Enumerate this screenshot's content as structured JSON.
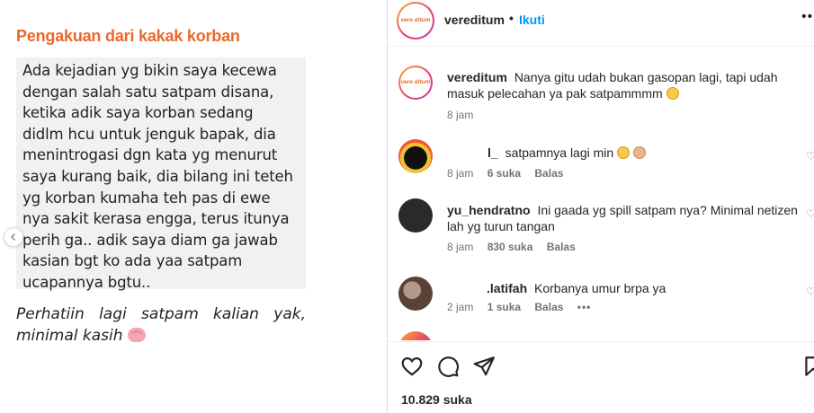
{
  "post": {
    "heading": "Pengakuan dari kakak korban",
    "quote": "Ada kejadian yg bikin saya kecewa\ndengan salah satu satpam disana,\nketika adik saya korban sedang\ndidlm hcu untuk jenguk bapak, dia\nmenintrogasi dgn kata yg menurut\nsaya kurang baik, dia bilang ini teteh\nyg korban kumaha teh pas di ewe\nnya sakit kerasa engga, terus itunya\nperih ga.. adik saya diam ga jawab\nkasian bgt ko ada yaa satpam\nucapannya bgtu..",
    "caption": "Perhatiin lagi satpam kalian yak, minimal kasih",
    "brain_emoji": "brain-emoji"
  },
  "header": {
    "avatar_text": "vere ditum",
    "username": "vereditum",
    "dot": "•",
    "follow_label": "Ikuti",
    "more_label": "••"
  },
  "caption_comment": {
    "username": "vereditum",
    "text": "Nanya gitu udah bukan gasopan lagi, tapi udah masuk pelecahan ya pak satpammmm",
    "time": "8 jam"
  },
  "comments": [
    {
      "username": "l_",
      "text": "satpamnya lagi min",
      "time": "8 jam",
      "likes": "6 suka",
      "reply": "Balas"
    },
    {
      "username": "yu_hendratno",
      "text": "Ini gaada yg spill satpam nya? Minimal netizen lah yg turun tangan",
      "time": "8 jam",
      "likes": "830 suka",
      "reply": "Balas"
    },
    {
      "username": ".latifah",
      "text": "Korbanya umur brpa ya",
      "time": "2 jam",
      "likes": "1 suka",
      "reply": "Balas",
      "more": "•••"
    }
  ],
  "actions": {
    "likes_count": "10.829 suka"
  },
  "colors": {
    "heading_orange": "#e8692b",
    "link_blue": "#0095f6",
    "quote_bg": "#f1f1f1"
  }
}
